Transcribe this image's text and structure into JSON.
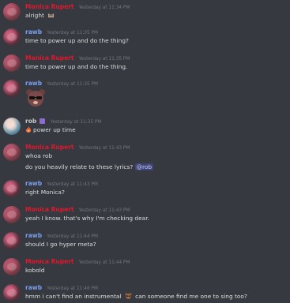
{
  "messages": [
    {
      "author": "Monica Rupert",
      "author_style": "monica",
      "timestamp": "Yesterday at 11:34 PM",
      "lines": [
        "alright"
      ],
      "trailing_emoji": "cat-face-emoji"
    },
    {
      "author": "rawb",
      "author_style": "rawb",
      "timestamp": "Yesterday at 11:35 PM",
      "lines": [
        "time to power up and do the thing?"
      ]
    },
    {
      "author": "Monica Rupert",
      "author_style": "monica",
      "timestamp": "Yesterday at 11:35 PM",
      "lines": [
        "time to power up and do the thing."
      ]
    },
    {
      "author": "rawb",
      "author_style": "rawb",
      "timestamp": "Yesterday at 11:35 PM",
      "lines": [],
      "sticker": "bear-sunglasses-sticker"
    },
    {
      "author": "rob",
      "author_style": "rob",
      "timestamp": "Yesterday at 11:35 PM",
      "lines": [
        "power up time"
      ],
      "leading_emoji": "fire-emoji"
    },
    {
      "author": "Monica Rupert",
      "author_style": "monica",
      "timestamp": "Yesterday at 11:43 PM",
      "lines": [
        "whoa rob",
        "do you heavily relate to these lyrics?"
      ],
      "mention": "@rob"
    },
    {
      "author": "rawb",
      "author_style": "rawb",
      "timestamp": "Yesterday at 11:43 PM",
      "lines": [
        "right Monica?"
      ]
    },
    {
      "author": "Monica Rupert",
      "author_style": "monica",
      "timestamp": "Yesterday at 11:43 PM",
      "lines": [
        "yeah I know. that's why I'm checking dear."
      ]
    },
    {
      "author": "rawb",
      "author_style": "rawb",
      "timestamp": "Yesterday at 11:44 PM",
      "lines": [
        "should I go hyper meta?"
      ]
    },
    {
      "author": "Monica Rupert",
      "author_style": "monica",
      "timestamp": "Yesterday at 11:44 PM",
      "lines": [
        "kobold"
      ]
    },
    {
      "author": "rawb",
      "author_style": "rawb",
      "timestamp": "Yesterday at 11:46 PM",
      "lines": [
        "hmm i can't find an instrumental",
        "can someone find me one to sing too?"
      ]
    }
  ],
  "colors": {
    "background": "#36393f",
    "monica": "#e0182f",
    "rawb": "#7b9ff0",
    "rob": "#c7c7c7",
    "timestamp": "#72767d",
    "text": "#dcddde"
  }
}
